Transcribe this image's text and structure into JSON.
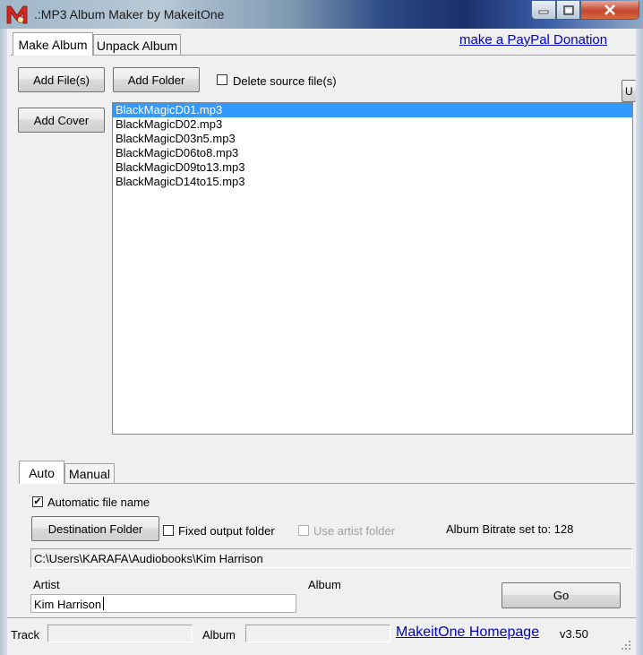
{
  "window": {
    "title": ".:MP3 Album Maker by MakeitOne",
    "logo_text": "M"
  },
  "main_tabs": [
    {
      "label": "Make Album",
      "active": true
    },
    {
      "label": "Unpack Album",
      "active": false
    }
  ],
  "donation_link": "make a PayPal Donation",
  "toolbar": {
    "add_files": "Add File(s)",
    "add_folder": "Add Folder",
    "delete_source": "Delete source file(s)",
    "delete_source_checked": false,
    "add_cover": "Add Cover",
    "side_button": "U"
  },
  "files": [
    {
      "name": "BlackMagicD01.mp3",
      "selected": true
    },
    {
      "name": "BlackMagicD02.mp3",
      "selected": false
    },
    {
      "name": "BlackMagicD03n5.mp3",
      "selected": false
    },
    {
      "name": "BlackMagicD06to8.mp3",
      "selected": false
    },
    {
      "name": "BlackMagicD09to13.mp3",
      "selected": false
    },
    {
      "name": "BlackMagicD14to15.mp3",
      "selected": false
    }
  ],
  "sub_tabs": [
    {
      "label": "Auto",
      "active": true
    },
    {
      "label": "Manual",
      "active": false
    }
  ],
  "auto": {
    "automatic_file_name": "Automatic file name",
    "automatic_file_name_checked": true,
    "destination_folder": "Destination Folder",
    "fixed_output_folder": "Fixed output folder",
    "fixed_output_checked": false,
    "use_artist_folder": "Use artist folder",
    "use_artist_checked": false,
    "bitrate_label": "Album Bitrate set to: 128",
    "path": "C:\\Users\\KARAFA\\Audiobooks\\Kim Harrison",
    "artist_label": "Artist",
    "artist_value": "Kim Harrison",
    "album_label": "Album",
    "go_button": "Go"
  },
  "status": {
    "track_label": "Track",
    "album_label": "Album",
    "homepage_link": "MakeitOne Homepage",
    "version": "v3.50"
  },
  "colors": {
    "selection": "#3399ff",
    "link": "#0000cc"
  }
}
